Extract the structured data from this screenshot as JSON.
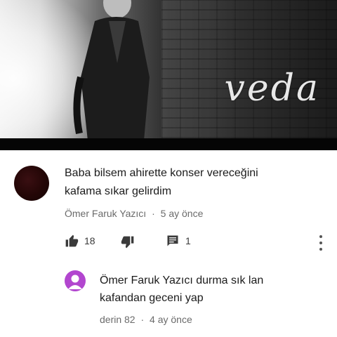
{
  "video": {
    "title_overlay": "veda"
  },
  "comment": {
    "text_line1": "Baba bilsem ahirette konser vereceğini",
    "text_line2": "kafama sıkar gelirdim",
    "author": "Ömer Faruk Yazıcı",
    "separator": "·",
    "time": "5 ay önce",
    "likes": "18",
    "replies": "1"
  },
  "reply": {
    "text_line1": "Ömer Faruk Yazıcı durma sık lan",
    "text_line2": "kafandan geceni yap",
    "author": "derin 82",
    "separator": "·",
    "time": "4 ay önce"
  },
  "colors": {
    "reply_avatar": "#b246cf",
    "main_avatar": "#230606"
  },
  "icons": [
    "thumbs-up-icon",
    "thumbs-down-icon",
    "reply-comment-icon",
    "more-vert-icon",
    "person-icon"
  ]
}
